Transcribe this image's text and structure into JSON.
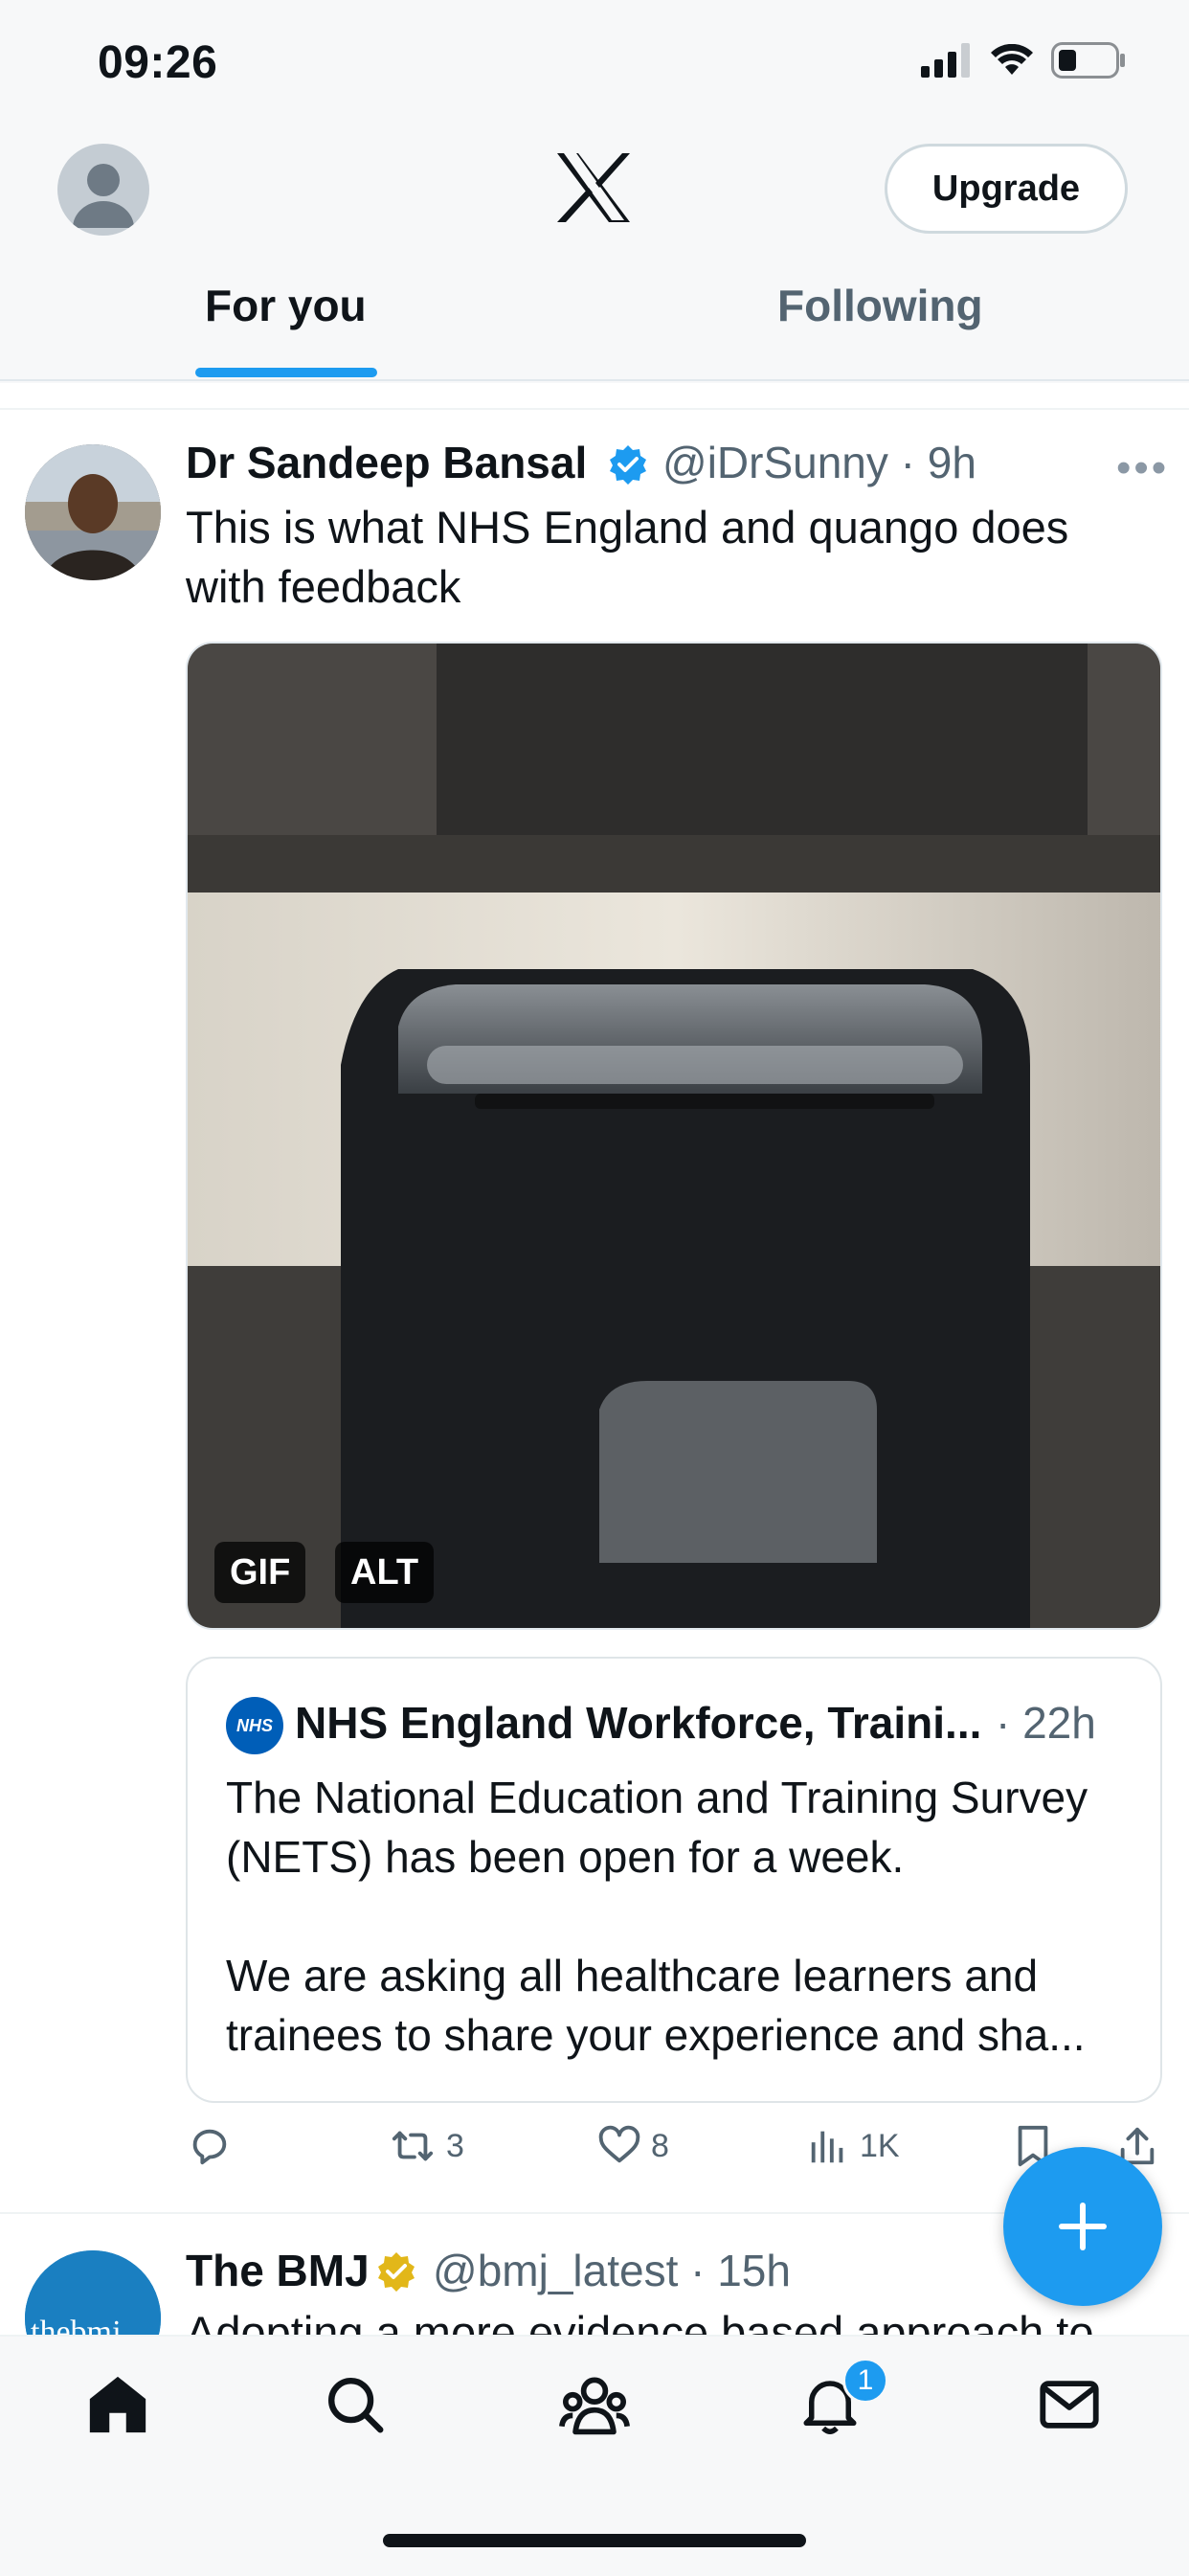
{
  "status_bar": {
    "time": "09:26"
  },
  "header": {
    "upgrade_label": "Upgrade"
  },
  "tabs": [
    {
      "label": "For you",
      "active": true
    },
    {
      "label": "Following",
      "active": false
    }
  ],
  "tweets": [
    {
      "name": "Dr Sandeep Bansal",
      "handle": "@iDrSunny · 9h",
      "text": "This is what NHS England and quango  does with feedback",
      "media_badges": [
        "GIF",
        "ALT"
      ],
      "quote": {
        "name": "NHS England Workforce, Traini...",
        "time": "· 22h",
        "logo_text": "NHS",
        "text": "The National Education and Training Survey (NETS) has been open for a week.\n\nWe are asking all healthcare learners and trainees to share your experience and sha..."
      },
      "actions": {
        "reply": "",
        "retweets": "3",
        "likes": "8",
        "views": "1K"
      }
    },
    {
      "name": "The BMJ",
      "handle": "@bmj_latest · 15h",
      "avatar_text": "thebmj",
      "text": "Adopting a more evidence based approach to"
    }
  ],
  "bottom_nav": {
    "notifications_count": "1"
  },
  "colors": {
    "accent": "#1d9bf0",
    "text": "#0f1419",
    "secondary": "#536471",
    "gold_badge": "#e2b719"
  }
}
